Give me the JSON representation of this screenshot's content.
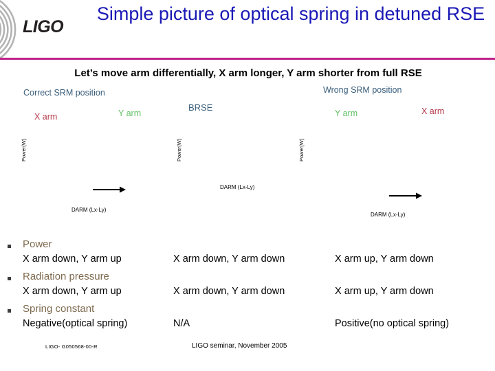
{
  "header": {
    "logo_text": "LIGO",
    "logo_icon": "ligo-concentric-arcs-logo",
    "title": "Simple picture of optical spring in detuned RSE",
    "title_color": "#1a19b5",
    "rule_color": "#bf2189"
  },
  "subtitle": "Let’s move arm differentially, X arm longer, Y arm shorter from full RSE",
  "diagram": {
    "captions": {
      "correct": "Correct SRM position",
      "wrong": "Wrong SRM position",
      "brsm": "BRSE",
      "caption_color": "#3a5f7d"
    },
    "arm_labels": {
      "x_left": "X arm",
      "y_left": "Y arm",
      "y_right": "Y arm",
      "x_right": "X arm",
      "x_color": "#b5394a",
      "y_color": "#63c168"
    },
    "axis_labels": {
      "left": "Power(W)",
      "middle": "Power(W)",
      "right": "Power(W)"
    },
    "darm_labels": {
      "left": "DARM (Lx-Ly)",
      "middle": "DARM (Lx-Ly)",
      "right": "DARM (Lx-Ly)"
    },
    "arrow_icon": "right-arrow-icon"
  },
  "comparison": {
    "bullet_color": "#3d3d3d",
    "heading_color": "#7d6a4e",
    "groups": [
      {
        "heading": "Power",
        "cells": [
          "X arm down, Y arm up",
          "X arm down, Y arm down",
          "X arm up, Y arm down"
        ]
      },
      {
        "heading": "Radiation pressure",
        "cells": [
          "X arm down, Y arm up",
          "X arm down, Y arm down",
          "X arm up, Y arm down"
        ]
      },
      {
        "heading": "Spring constant",
        "cells": [
          "Negative(optical spring)",
          "N/A",
          "Positive(no optical spring)"
        ]
      }
    ]
  },
  "footer": {
    "document_number": "LIGO- G050568-00-R",
    "event": "LIGO seminar, November 2005"
  }
}
